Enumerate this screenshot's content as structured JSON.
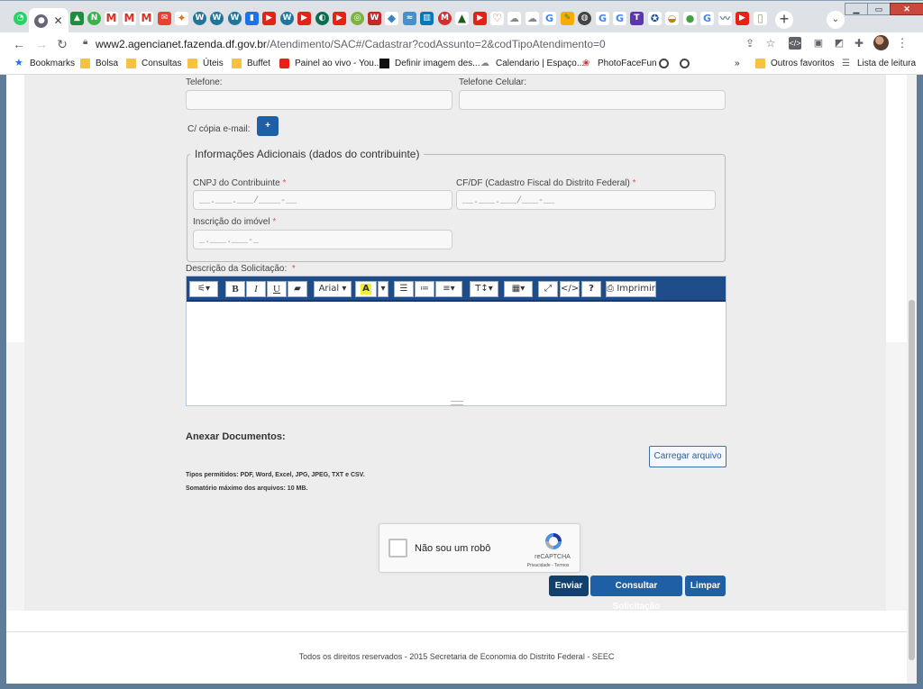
{
  "browser": {
    "url_host": "www2.agencianet.fazenda.df.gov.br",
    "url_path": "/Atendimento/SAC#/Cadastrar?codAssunto=2&codTipoAtendimento=0",
    "bookmarks": [
      "Bookmarks",
      "Bolsa",
      "Consultas",
      "Úteis",
      "Buffet",
      "Painel ao vivo - You...",
      "Definir imagem des...",
      "Calendario | Espaço...",
      "PhotoFaceFun"
    ],
    "chevron": "»",
    "other_favorites": "Outros favoritos",
    "reading_list": "Lista de leitura"
  },
  "form": {
    "telefone_label": "Telefone:",
    "celular_label": "Telefone Celular:",
    "copia_label": "C/ cópia e-mail:",
    "add_button": "+",
    "fieldset_legend": "Informações Adicionais (dados do contribuinte)",
    "cnpj_label": "CNPJ do Contribuinte",
    "cnpj_mask": "__.___.___/____-__",
    "cfdf_label": "CF/DF (Cadastro Fiscal do Distrito Federal)",
    "cfdf_mask": "__.___.___/___-__",
    "inscricao_label": "Inscrição do imóvel",
    "inscricao_mask": "_.___.___-_",
    "required_mark": "*",
    "descricao_label": "Descrição da Solicitação:"
  },
  "editor": {
    "font": "Arial ▾",
    "print": "Imprimir"
  },
  "attachments": {
    "title": "Anexar Documentos:",
    "upload_button": "Carregar arquivo",
    "allowed": "Tipos permitidos: PDF, Word, Excel, JPG, JPEG, TXT e CSV.",
    "max_size": "Somatório máximo dos arquivos: 10 MB."
  },
  "captcha": {
    "label": "Não sou um robô",
    "brand": "reCAPTCHA",
    "terms": "Privacidade - Termos"
  },
  "actions": {
    "send": "Enviar",
    "consult": "Consultar Solicitação",
    "clear": "Limpar"
  },
  "footer": "Todos os direitos reservados - 2015 Secretaria de Economia do Distrito Federal - SEEC",
  "colors": {
    "primary": "#1e5fa6",
    "send": "#113f6e",
    "toolbar": "#1f4d8a",
    "required": "#d9534f"
  }
}
